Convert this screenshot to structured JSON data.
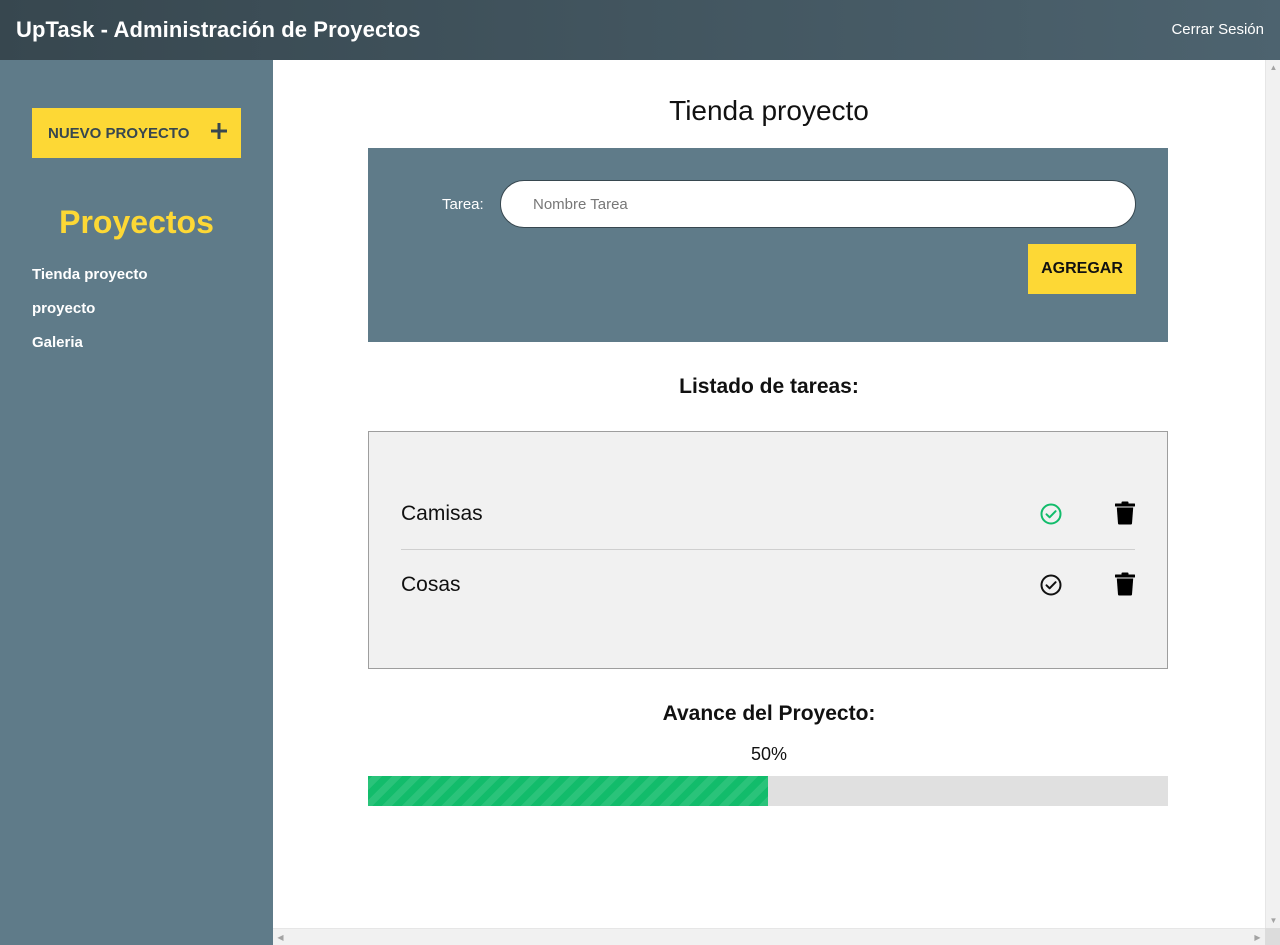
{
  "header": {
    "title": "UpTask - Administración de Proyectos",
    "logout_label": "Cerrar Sesión"
  },
  "sidebar": {
    "new_project_label": "NUEVO PROYECTO",
    "new_project_icon": "plus-icon",
    "heading": "Proyectos",
    "projects": [
      {
        "label": "Tienda proyecto"
      },
      {
        "label": "proyecto"
      },
      {
        "label": "Galeria"
      }
    ]
  },
  "main": {
    "project_title": "Tienda proyecto",
    "form": {
      "task_label": "Tarea:",
      "task_placeholder": "Nombre Tarea",
      "task_value": "",
      "add_button_label": "AGREGAR"
    },
    "list_heading": "Listado de tareas:",
    "tasks": [
      {
        "name": "Camisas",
        "completed": true,
        "status_icon": "check-circle-icon",
        "delete_icon": "trash-icon"
      },
      {
        "name": "Cosas",
        "completed": false,
        "status_icon": "check-circle-icon",
        "delete_icon": "trash-icon"
      }
    ],
    "progress": {
      "heading": "Avance del Proyecto:",
      "percent_text": "50%",
      "fraction": 0.5
    }
  },
  "colors": {
    "accent_yellow": "#fdd835",
    "sidebar_bg": "#5f7b89",
    "header_bg": "#37474f",
    "success_green": "#12bc6b",
    "pending_black": "#111111"
  }
}
